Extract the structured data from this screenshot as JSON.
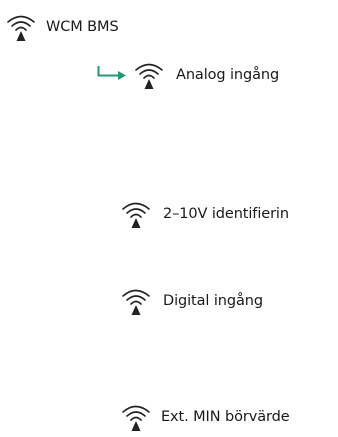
{
  "colors": {
    "text": "#1a1a1a",
    "icon": "#222222",
    "accent_arrow": "#1f9a6e"
  },
  "icons": {
    "signal": "wireless-signal-icon",
    "arrow": "return-arrow-icon"
  },
  "menu": {
    "root": {
      "label": "WCM BMS"
    },
    "selected_child": {
      "label": "Analog ingång"
    },
    "items": [
      {
        "label": "2–10V identifierin"
      },
      {
        "label": "Digital ingång"
      },
      {
        "label": "Ext. MIN börvärde"
      }
    ]
  }
}
